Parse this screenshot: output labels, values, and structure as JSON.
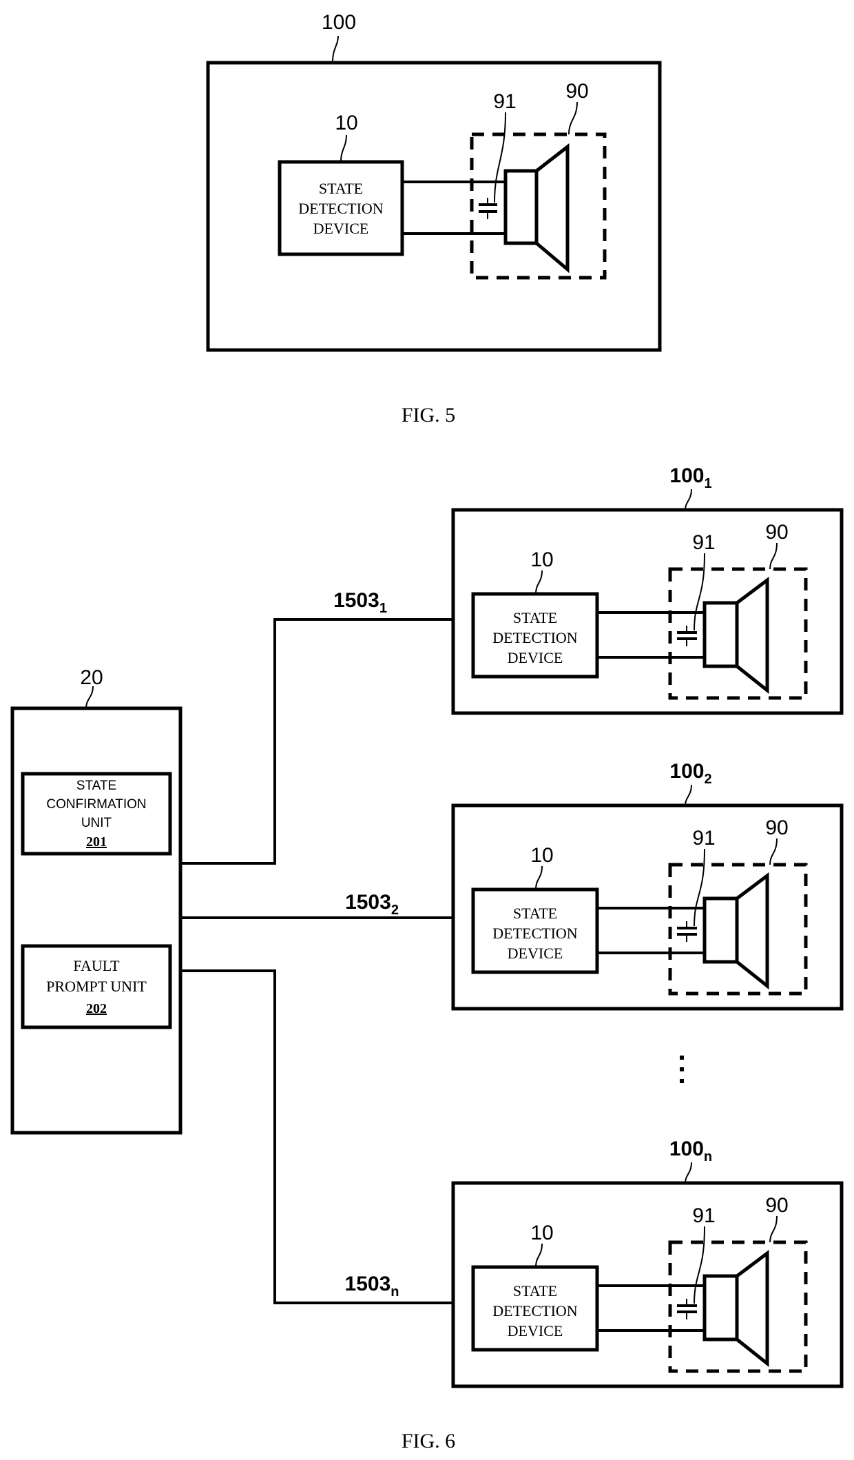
{
  "fig5": {
    "caption": "FIG. 5",
    "system_ref": "100",
    "device_ref": "10",
    "device_label": [
      "STATE",
      "DETECTION",
      "DEVICE"
    ],
    "speaker_ref": "90",
    "capacitor_ref": "91"
  },
  "fig6": {
    "caption": "FIG. 6",
    "controller": {
      "ref": "20",
      "units": [
        {
          "label": [
            "STATE",
            "CONFIRMATION",
            "UNIT"
          ],
          "ref": "201"
        },
        {
          "label": [
            "FAULT",
            "PROMPT UNIT"
          ],
          "ref": "202"
        }
      ]
    },
    "channels": [
      {
        "bus_ref": "1503",
        "bus_sub": "1",
        "system_ref": "100",
        "system_sub": "1"
      },
      {
        "bus_ref": "1503",
        "bus_sub": "2",
        "system_ref": "100",
        "system_sub": "2"
      },
      {
        "bus_ref": "1503",
        "bus_sub": "n",
        "system_ref": "100",
        "system_sub": "n"
      }
    ],
    "device_ref": "10",
    "device_label": [
      "STATE",
      "DETECTION",
      "DEVICE"
    ],
    "speaker_ref": "90",
    "capacitor_ref": "91",
    "ellipsis": "⋮"
  }
}
